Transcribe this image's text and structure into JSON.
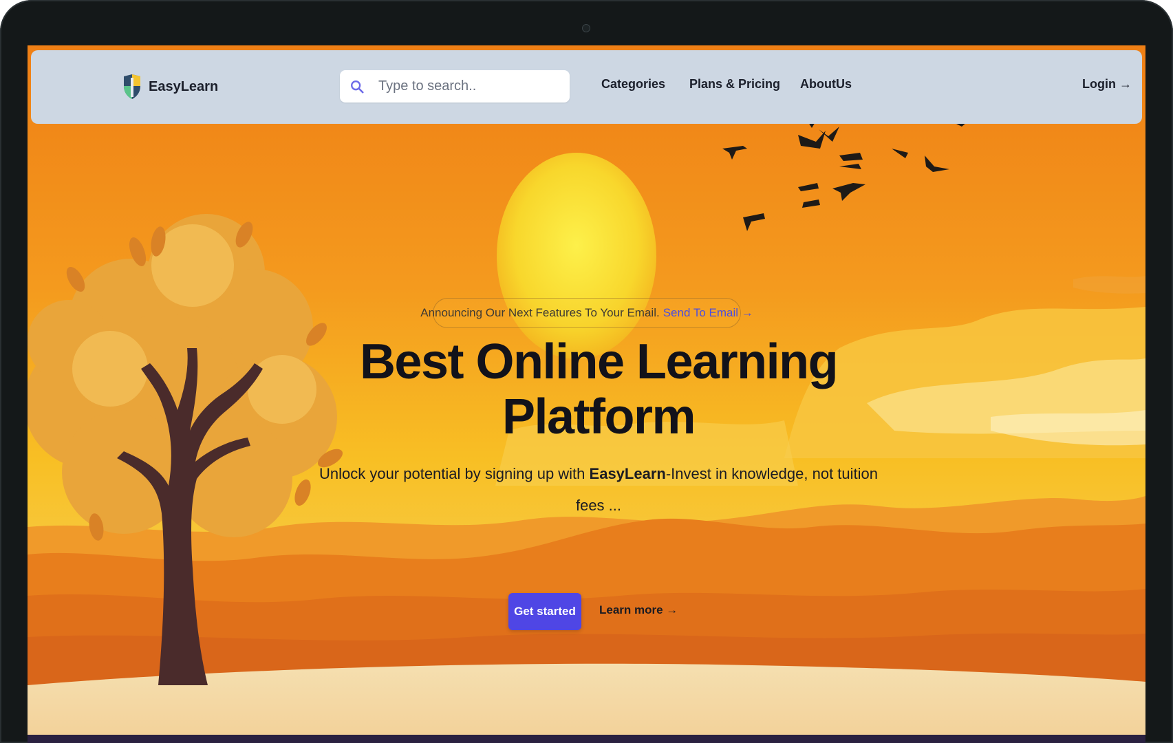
{
  "brand": {
    "name": "EasyLearn"
  },
  "search": {
    "placeholder": "Type to search.."
  },
  "nav": {
    "links": [
      {
        "label": "Categories"
      },
      {
        "label": "Plans & Pricing"
      },
      {
        "label": "AboutUs"
      }
    ],
    "login_label": "Login →"
  },
  "hero": {
    "announcement_text": "Announcing Our Next Features To Your Email.",
    "announcement_link": "Send To Email →",
    "title_line1": "Best Online Learning",
    "title_line2": "Platform",
    "subtitle_before": "Unlock your potential by signing up with ",
    "subtitle_brand": "EasyLearn",
    "subtitle_after": "-Invest in knowledge, not tuition fees ...",
    "primary_button": "Get started",
    "secondary_link": "Learn more →"
  },
  "colors": {
    "accent": "#4f46e5",
    "navbar_bg": "#cdd7e3",
    "sky_orange": "#f28a1a",
    "sun_yellow": "#f6e02c",
    "tree_trunk": "#4a2b2b",
    "device_frame": "#141819"
  }
}
